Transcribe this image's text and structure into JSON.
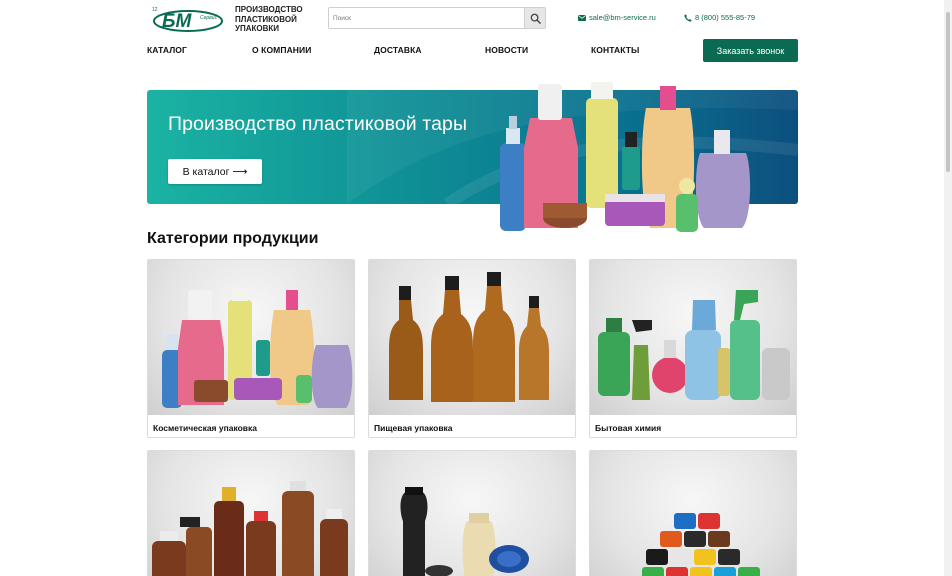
{
  "header": {
    "logo_text": "БМ",
    "logo_sub": "Сервис",
    "logo_mark": "12",
    "tagline": "ПРОИЗВОДСТВО ПЛАСТИКОВОЙ УПАКОВКИ",
    "search_placeholder": "Поиск",
    "email": "sale@bm-service.ru",
    "phone": "8 (800) 555-85-79"
  },
  "nav": {
    "items": [
      "КАТАЛОГ",
      "О КОМПАНИИ",
      "ДОСТАВКА",
      "НОВОСТИ",
      "КОНТАКТЫ"
    ],
    "callback_label": "Заказать звонок"
  },
  "hero": {
    "title": "Производство пластиковой тары",
    "button_label": "В каталог ⟶"
  },
  "categories": {
    "title": "Категории продукции",
    "items": [
      {
        "label": "Косметическая упаковка"
      },
      {
        "label": "Пищевая упаковка"
      },
      {
        "label": "Бытовая химия"
      },
      {
        "label": ""
      },
      {
        "label": ""
      },
      {
        "label": ""
      }
    ]
  },
  "colors": {
    "brand_green": "#0a6b52",
    "contact_green": "#0f6b4c",
    "hero_start": "#1bb3a3",
    "hero_end": "#0c4f7e"
  },
  "icons": {
    "search": "search-icon",
    "email": "envelope-icon",
    "phone": "phone-icon"
  }
}
